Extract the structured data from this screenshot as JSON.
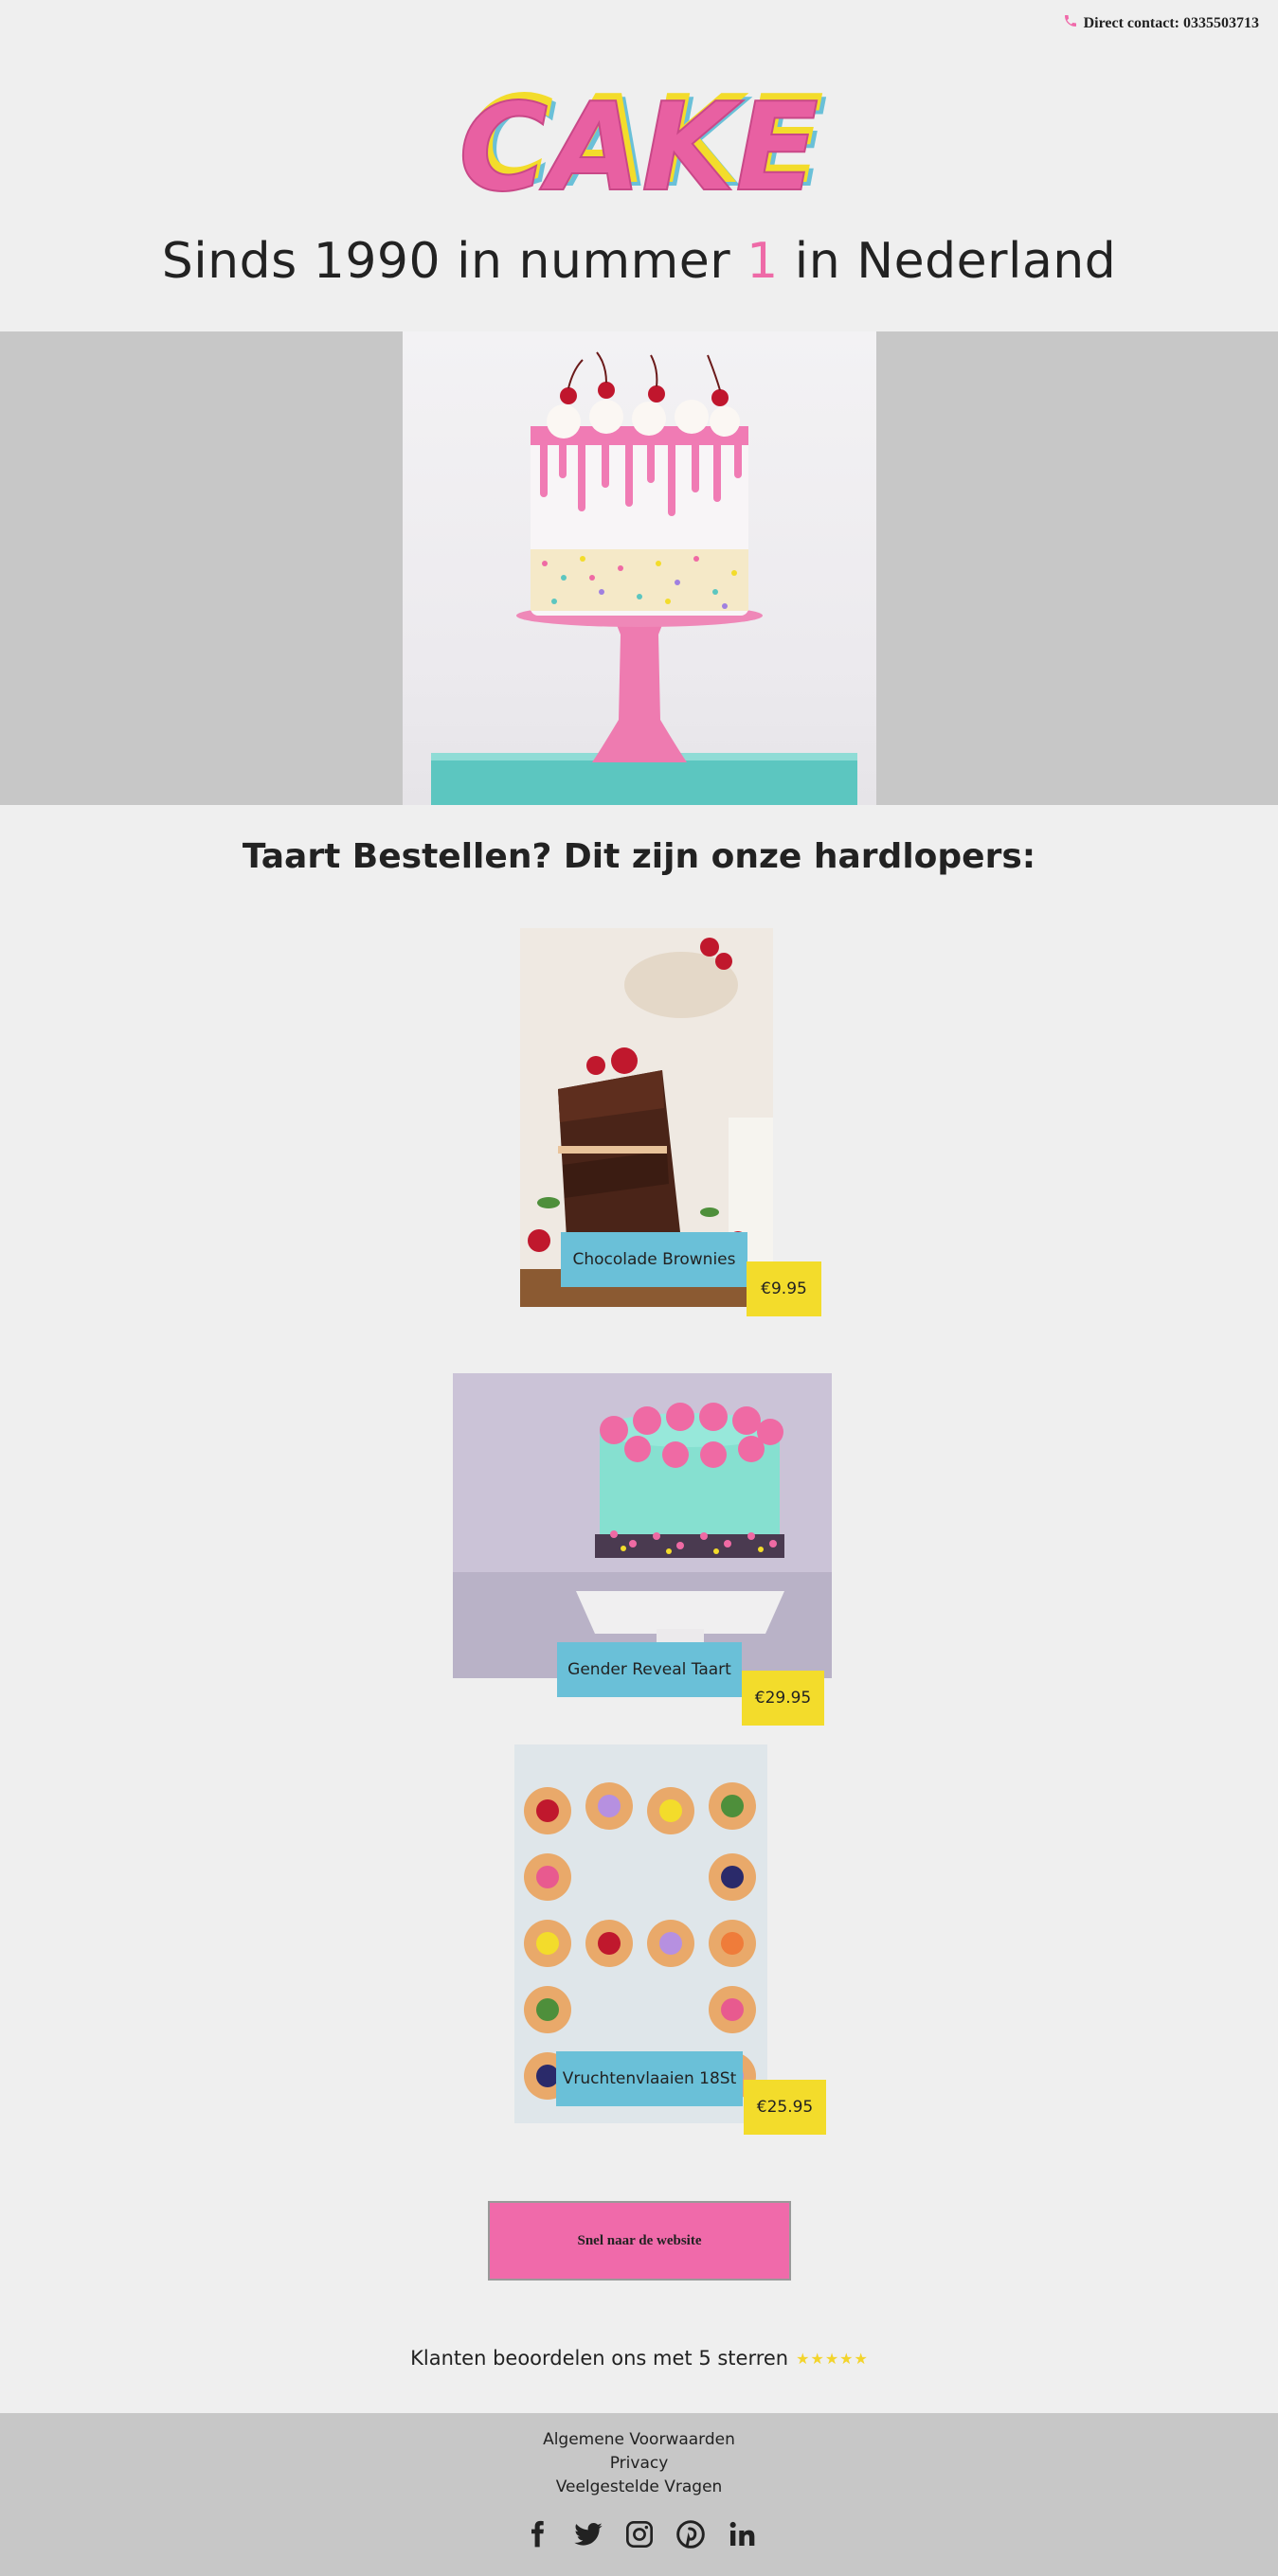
{
  "header": {
    "contact_text": "Direct contact: 0335503713"
  },
  "logo": {
    "text": "CAKE"
  },
  "headline": {
    "before": "Sinds 1990 in nummer ",
    "accent": "1",
    "after": " in Nederland"
  },
  "section_title": "Taart Bestellen? Dit zijn onze hardlopers:",
  "products": [
    {
      "name": "Chocolade Brownies",
      "price": "€9.95"
    },
    {
      "name": "Gender Reveal Taart",
      "price": "€29.95"
    },
    {
      "name": "Vruchtenvlaaien 18St",
      "price": "€25.95"
    }
  ],
  "cta": {
    "label": "Snel naar de website"
  },
  "rating": {
    "text": "Klanten beoordelen ons met 5 sterren",
    "stars": 5
  },
  "footer": {
    "links": [
      "Algemene Voorwaarden",
      "Privacy",
      "Veelgestelde Vragen"
    ],
    "socials": [
      "facebook-icon",
      "twitter-icon",
      "instagram-icon",
      "pinterest-icon",
      "linkedin-icon"
    ]
  },
  "colors": {
    "pink": "#f06aaa",
    "blue": "#6ac0d8",
    "yellow": "#f3dc2b",
    "background": "#efefef",
    "band": "#c7c7c7"
  }
}
